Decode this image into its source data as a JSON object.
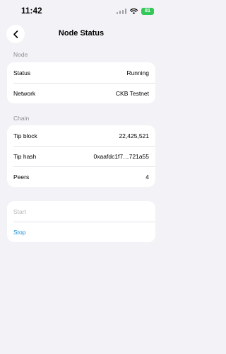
{
  "status_bar": {
    "time": "11:42",
    "battery": "81"
  },
  "header": {
    "title": "Node Status"
  },
  "node_section": {
    "label": "Node",
    "rows": [
      {
        "label": "Status",
        "value": "Running"
      },
      {
        "label": "Network",
        "value": "CKB Testnet"
      }
    ]
  },
  "chain_section": {
    "label": "Chain",
    "rows": [
      {
        "label": "Tip block",
        "value": "22,425,521"
      },
      {
        "label": "Tip hash",
        "value": "0xaafdc1f7…721a55"
      },
      {
        "label": "Peers",
        "value": "4"
      }
    ]
  },
  "actions": {
    "start_label": "Start",
    "stop_label": "Stop"
  },
  "colors": {
    "background": "#f2f2f7",
    "battery": "#34c759",
    "disabled": "#b8b8bd",
    "action": "#1a8fd6"
  },
  "icons": [
    "back-chevron-icon",
    "signal-icon",
    "wifi-icon",
    "battery-icon"
  ]
}
